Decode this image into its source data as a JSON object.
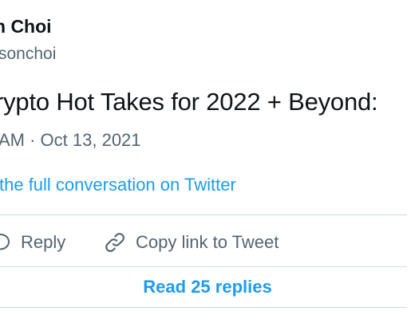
{
  "author": {
    "name": "n Choi",
    "handle": "sonchoi"
  },
  "tweet": {
    "text": "rypto Hot Takes for 2022 + Beyond:",
    "timestamp": "AM · Oct 13, 2021"
  },
  "links": {
    "conversation": "the full conversation on Twitter"
  },
  "actions": {
    "reply_label": "Reply",
    "reply_icon": "reply-bubble-icon",
    "copy_label": "Copy link to Tweet",
    "copy_icon": "link-icon"
  },
  "footer": {
    "read_replies": "Read 25 replies"
  },
  "colors": {
    "text": "#0f1419",
    "secondary": "#536471",
    "accent": "#1d9bf0",
    "divider": "#cfd9de"
  }
}
